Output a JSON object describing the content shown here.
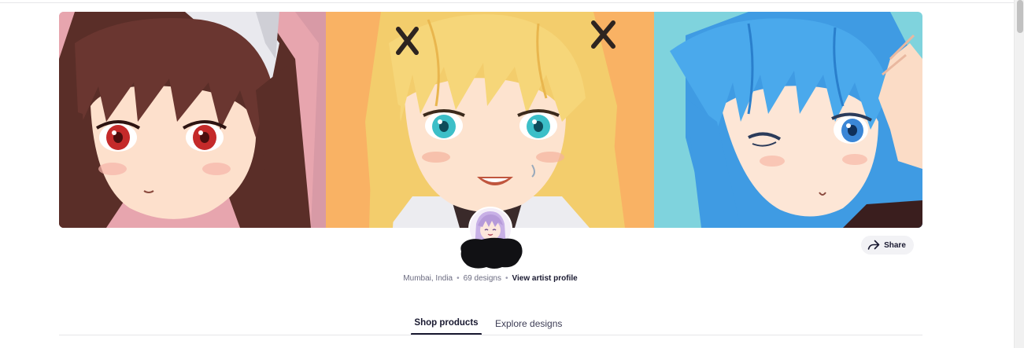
{
  "banner": {
    "panels": [
      {
        "name": "left",
        "background": "#d89aa6",
        "hair": "#5a2e28",
        "eyes": "#c42a2a"
      },
      {
        "name": "center",
        "background": "#f9b264",
        "hair": "#f3cd6c",
        "eyes": "#3cbfc8"
      },
      {
        "name": "right",
        "background": "#7fd3dd",
        "hair": "#3f9be3",
        "eyes": "#3a86d6"
      }
    ]
  },
  "profile": {
    "avatar_icon": "artist-avatar",
    "location": "Mumbai, India",
    "design_count": "69 designs",
    "view_profile_label": "View artist profile"
  },
  "share": {
    "label": "Share",
    "icon": "share-arrow-icon"
  },
  "tabs": [
    {
      "label": "Shop products",
      "active": true
    },
    {
      "label": "Explore designs",
      "active": false
    }
  ],
  "colors": {
    "text_primary": "#191930",
    "text_secondary": "#6b6b80",
    "divider": "#e6e6e9"
  }
}
